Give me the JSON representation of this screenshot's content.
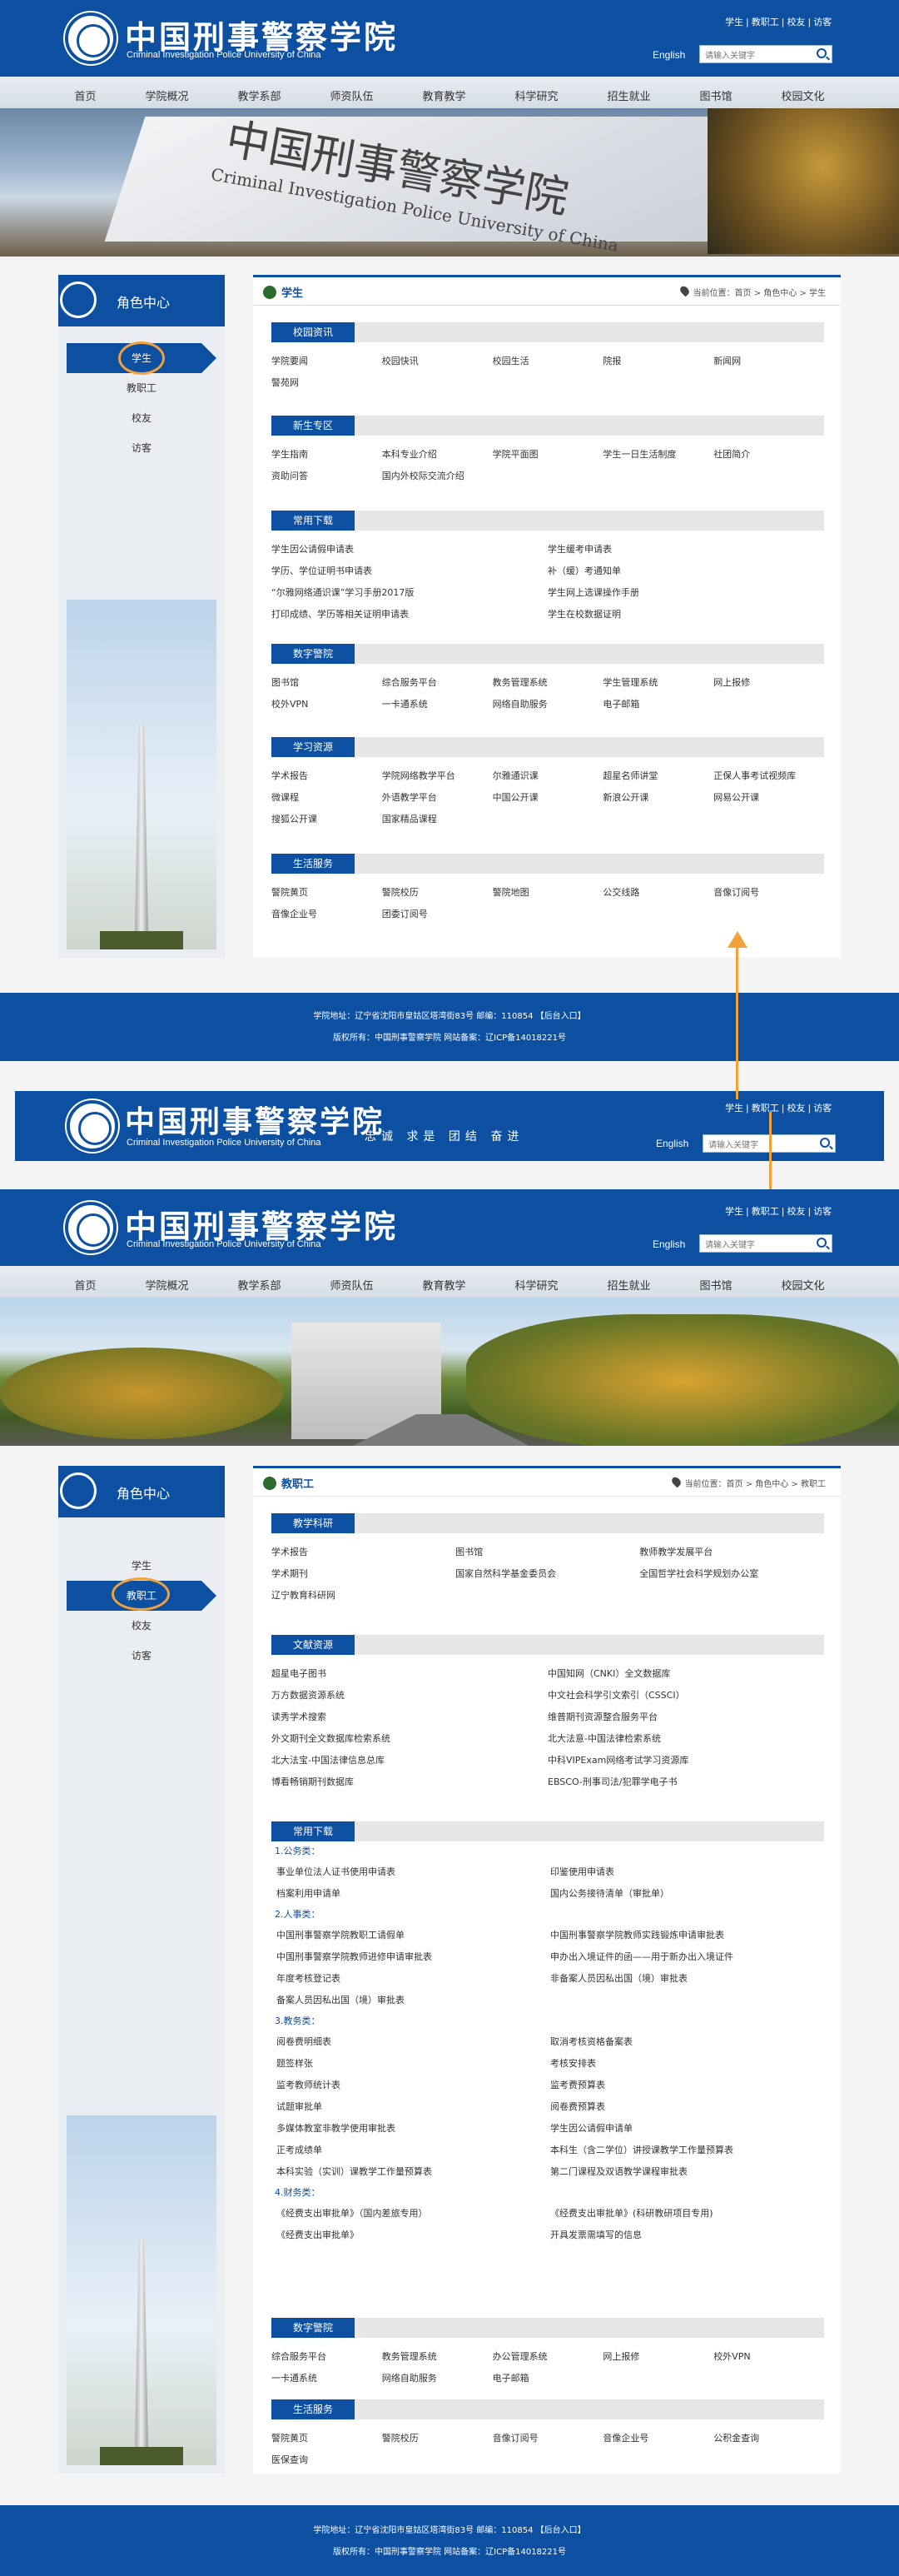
{
  "header": {
    "logo_cn": "中国刑事警察学院",
    "logo_en": "Criminal Investigation Police University of China",
    "top_links": [
      "学生",
      "教职工",
      "校友",
      "访客"
    ],
    "lang": "English",
    "search_placeholder": "请输入关键字"
  },
  "nav": [
    "首页",
    "学院概况",
    "教学系部",
    "师资队伍",
    "教育教学",
    "科学研究",
    "招生就业",
    "图书馆",
    "校园文化"
  ],
  "banner1": {
    "engraved_cn": "中国刑事警察学院",
    "engraved_en": "Criminal Investigation Police University of China"
  },
  "sidebar": {
    "title": "角色中心",
    "items": [
      "学生",
      "教职工",
      "校友",
      "访客"
    ]
  },
  "student_page": {
    "title": "学生",
    "breadcrumb": "当前位置：首页 > 角色中心 > 学生",
    "sections": [
      {
        "title": "校园资讯",
        "cols": 5,
        "links": [
          "学院要闻",
          "校园快讯",
          "校园生活",
          "院报",
          "新闻网",
          "警苑网"
        ]
      },
      {
        "title": "新生专区",
        "cols": 5,
        "links": [
          "学生指南",
          "本科专业介绍",
          "学院平面图",
          "学生一日生活制度",
          "社团简介",
          "资助问答",
          "国内外校际交流介绍"
        ]
      },
      {
        "title": "常用下载",
        "cols": 2,
        "links": [
          "学生因公请假申请表",
          "学生缓考申请表",
          "学历、学位证明书申请表",
          "补（缓）考通知单",
          "“尔雅网络通识课”学习手册2017版",
          "学生网上选课操作手册",
          "打印成绩、学历等相关证明申请表",
          "学生在校数据证明"
        ]
      },
      {
        "title": "数字警院",
        "cols": 5,
        "links": [
          "图书馆",
          "综合服务平台",
          "教务管理系统",
          "学生管理系统",
          "网上报修",
          "校外VPN",
          "一卡通系统",
          "网络自助服务",
          "电子邮箱"
        ]
      },
      {
        "title": "学习资源",
        "cols": 5,
        "links": [
          "学术报告",
          "学院网络教学平台",
          "尔雅通识课",
          "超星名师讲堂",
          "正保人事考试视频库",
          "微课程",
          "外语教学平台",
          "中国公开课",
          "新浪公开课",
          "网易公开课",
          "搜狐公开课",
          "国家精品课程"
        ]
      },
      {
        "title": "生活服务",
        "cols": 5,
        "links": [
          "警院黄页",
          "警院校历",
          "警院地图",
          "公交线路",
          "音像订阅号",
          "音像企业号",
          "团委订阅号"
        ]
      }
    ]
  },
  "footer": {
    "line1": "学院地址：辽宁省沈阳市皇姑区塔湾街83号 邮编：110854 【后台入口】",
    "line2": "版权所有：中国刑事警察学院 网站备案：辽ICP备14018221号"
  },
  "strip": {
    "slogan": "忠诚 求是 团结 奋进",
    "lang": "English",
    "search_placeholder": "请输入关键字"
  },
  "staff_page": {
    "title": "教职工",
    "breadcrumb": "当前位置：首页 > 角色中心 > 教职工",
    "sec_research": {
      "title": "教学科研",
      "links": [
        "学术报告",
        "图书馆",
        "教师教学发展平台",
        "学术期刊",
        "国家自然科学基金委员会",
        "全国哲学社会科学规划办公室",
        "辽宁教育科研网"
      ]
    },
    "sec_lit": {
      "title": "文献资源",
      "links": [
        "超星电子图书",
        "中国知网（CNKI）全文数据库",
        "万方数据资源系统",
        "中文社会科学引文索引（CSSCI）",
        "读秀学术搜索",
        "维普期刊资源整合服务平台",
        "外文期刊全文数据库检索系统",
        "北大法意-中国法律检索系统",
        "北大法宝-中国法律信息总库",
        "中科VIPExam网络考试学习资源库",
        "博看畅销期刊数据库",
        "EBSCO-刑事司法/犯罪学电子书"
      ]
    },
    "sec_dl": {
      "title": "常用下载",
      "groups": [
        {
          "name": "1.公务类：",
          "links": [
            "事业单位法人证书使用申请表",
            "印鉴使用申请表",
            "档案利用申请单",
            "国内公务接待清单（审批单）"
          ]
        },
        {
          "name": "2.人事类：",
          "links": [
            "中国刑事警察学院教职工请假单",
            "中国刑事警察学院教师实践锻炼申请审批表",
            "中国刑事警察学院教师进修申请审批表",
            "申办出入境证件的函——用于新办出入境证件",
            "年度考核登记表",
            "非备案人员因私出国（境）审批表",
            "备案人员因私出国（境）审批表"
          ]
        },
        {
          "name": "3.教务类：",
          "links": [
            "阅卷费明细表",
            "取消考核资格备案表",
            "题签样张",
            "考核安排表",
            "监考教师统计表",
            "监考费预算表",
            "试题审批单",
            "阅卷费预算表",
            "多媒体教室非教学使用审批表",
            "学生因公请假申请单",
            "正考成绩单",
            "本科生（含二学位）讲授课教学工作量预算表",
            "本科实验（实训）课教学工作量预算表",
            "第二门课程及双语教学课程审批表"
          ]
        },
        {
          "name": "4.财务类：",
          "links": [
            "《经费支出审批单》（国内差旅专用）",
            "《经费支出审批单》(科研教研项目专用)",
            "《经费支出审批单》",
            "开具发票需填写的信息"
          ]
        }
      ]
    },
    "sec_digital": {
      "title": "数字警院",
      "links": [
        "综合服务平台",
        "教务管理系统",
        "办公管理系统",
        "网上报修",
        "校外VPN",
        "一卡通系统",
        "网络自助服务",
        "电子邮箱"
      ]
    },
    "sec_life": {
      "title": "生活服务",
      "links": [
        "警院黄页",
        "警院校历",
        "音像订阅号",
        "音像企业号",
        "公积金查询",
        "医保查询"
      ]
    }
  },
  "colors": {
    "brand": "#0d4fa0",
    "highlight": "#f2a23a"
  }
}
